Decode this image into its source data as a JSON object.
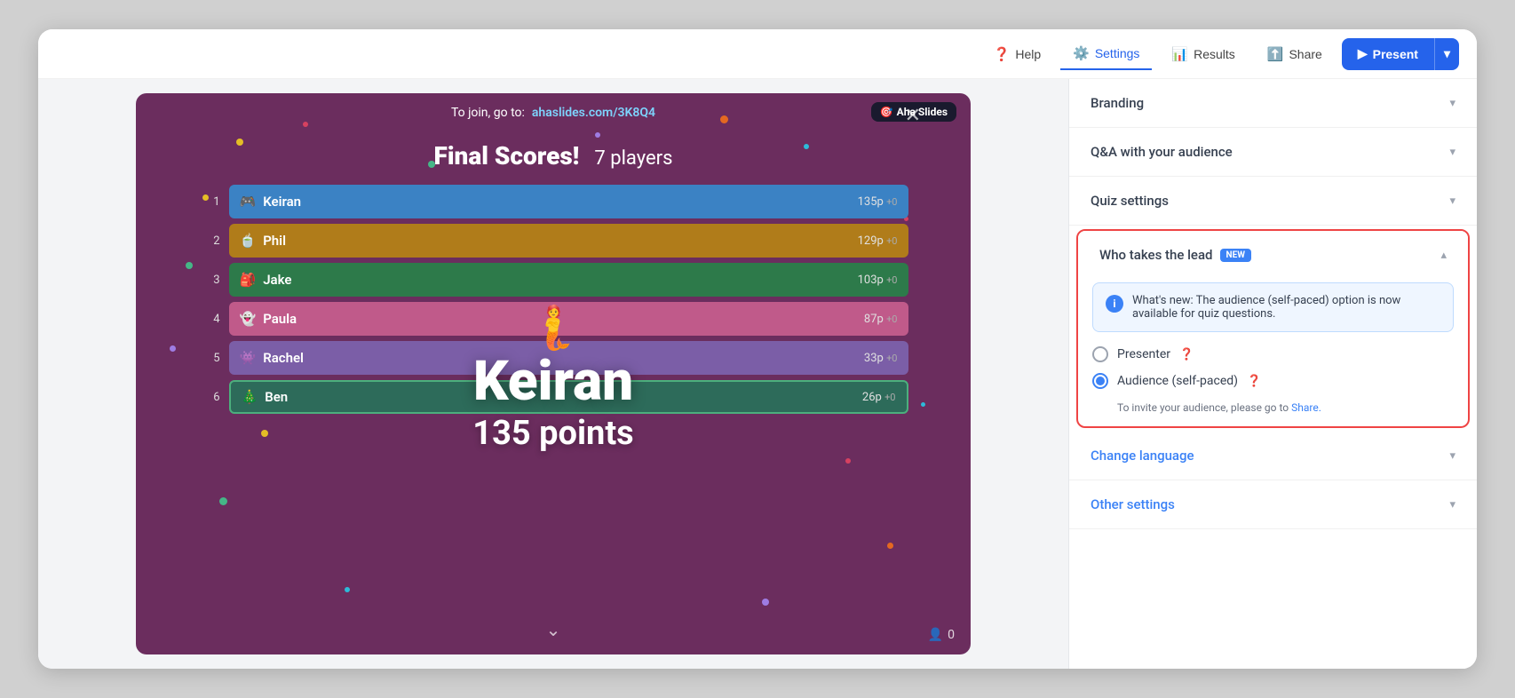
{
  "topbar": {
    "help_label": "Help",
    "settings_label": "Settings",
    "results_label": "Results",
    "share_label": "Share",
    "present_label": "Present"
  },
  "slide": {
    "join_text": "To join, go to:",
    "join_url": "ahaslides.com/3K8Q4",
    "aha_badge": "Aha Slides",
    "title": "Final Scores!",
    "players": "7 players",
    "winner_name": "Keiran",
    "winner_points": "135 points",
    "leaderboard": [
      {
        "rank": "1",
        "name": "Keiran",
        "score": "135p",
        "plus": "+0",
        "color_class": "rank1"
      },
      {
        "rank": "2",
        "name": "Phil",
        "score": "129p",
        "plus": "+0",
        "color_class": "rank2"
      },
      {
        "rank": "3",
        "name": "Jake",
        "score": "103p",
        "plus": "+0",
        "color_class": "rank3"
      },
      {
        "rank": "4",
        "name": "Paula",
        "score": "87p",
        "plus": "+0",
        "color_class": "rank4"
      },
      {
        "rank": "5",
        "name": "Rachel",
        "score": "33p",
        "plus": "+0",
        "color_class": "rank5"
      },
      {
        "rank": "6",
        "name": "Ben",
        "score": "26p",
        "plus": "+0",
        "color_class": "rank6"
      }
    ],
    "audience_count": "0"
  },
  "settings": {
    "branding_label": "Branding",
    "qa_label": "Q&A with your audience",
    "quiz_label": "Quiz settings",
    "who_lead_label": "Who takes the lead",
    "new_badge": "NEW",
    "info_text": "What's new: The audience (self-paced) option is now available for quiz questions.",
    "presenter_label": "Presenter",
    "audience_label": "Audience (self-paced)",
    "invite_text": "To invite your audience, please go to",
    "invite_link": "Share.",
    "change_lang_label": "Change language",
    "other_label": "Other settings"
  }
}
